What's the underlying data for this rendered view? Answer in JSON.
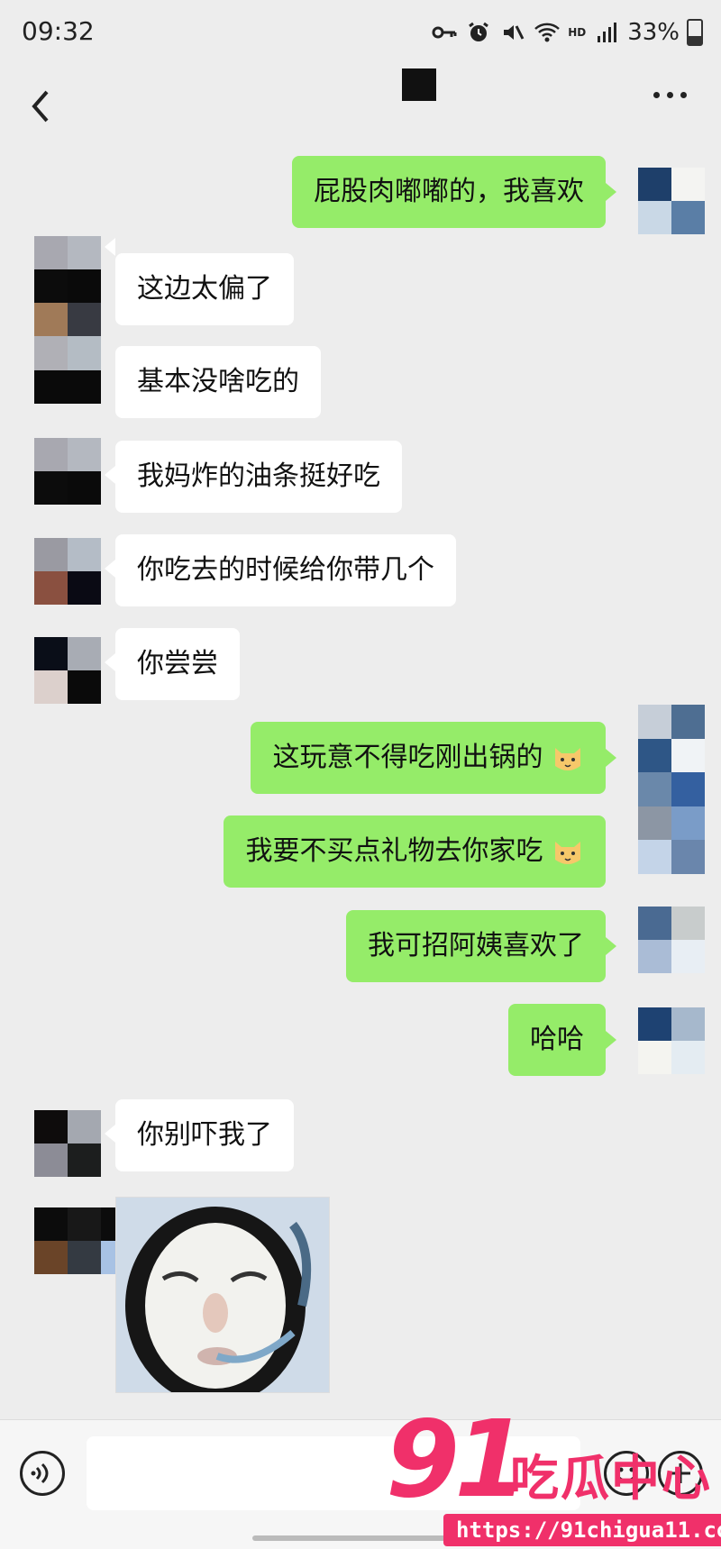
{
  "status_bar": {
    "time": "09:32",
    "network_label": "HD",
    "battery": "33%"
  },
  "colors": {
    "background": "#ededed",
    "my_bubble": "#95ec69",
    "their_bubble": "#ffffff",
    "watermark": "#f0306a"
  },
  "messages": [
    {
      "side": "me",
      "text": "屁股肉嘟嘟的，我喜欢"
    },
    {
      "side": "them",
      "text": "这边太偏了"
    },
    {
      "side": "them",
      "text": "基本没啥吃的"
    },
    {
      "side": "them",
      "text": "我妈炸的油条挺好吃"
    },
    {
      "side": "them",
      "text": "你吃去的时候给你带几个"
    },
    {
      "side": "them",
      "text": "你尝尝"
    },
    {
      "side": "me",
      "text": "这玩意不得吃刚出锅的",
      "emoji": "cat-face-icon"
    },
    {
      "side": "me",
      "text": "我要不买点礼物去你家吃",
      "emoji": "cat-face-icon"
    },
    {
      "side": "me",
      "text": "我可招阿姨喜欢了"
    },
    {
      "side": "me",
      "text": "哈哈"
    },
    {
      "side": "them",
      "text": "你别吓我了"
    },
    {
      "side": "them",
      "sticker": "cartoon-face-sticker"
    }
  ],
  "watermark": {
    "number": "91",
    "name": "吃瓜中心",
    "url": "https://91chigua11.com"
  }
}
